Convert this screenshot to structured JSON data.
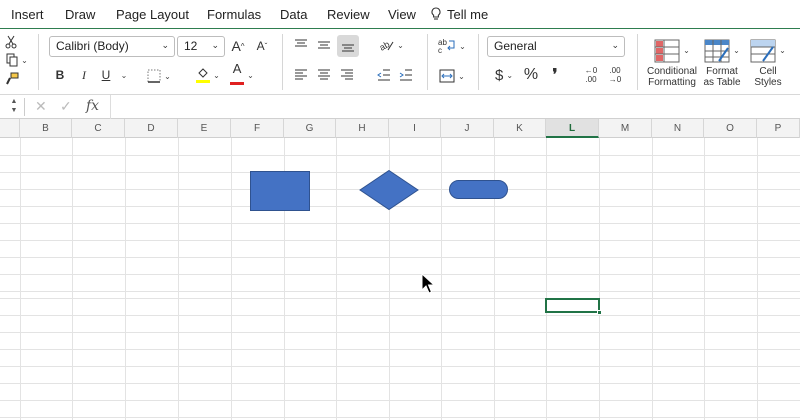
{
  "menu": {
    "tabs": [
      "Insert",
      "Draw",
      "Page Layout",
      "Formulas",
      "Data",
      "Review",
      "View"
    ],
    "tell_me": "Tell me"
  },
  "ribbon": {
    "font_name": "Calibri (Body)",
    "font_size": "12",
    "number_format": "General",
    "bold": "B",
    "italic": "I",
    "underline": "U",
    "font_color_letter": "A",
    "currency": "$",
    "percent": "%",
    "comma": "❜",
    "increase_decimal_top": "←0",
    "increase_decimal_bottom": ".00",
    "decrease_decimal_top": ".00",
    "decrease_decimal_bottom": "→0",
    "conditional_formatting": [
      "Conditional",
      "Formatting"
    ],
    "format_as_table": [
      "Format",
      "as Table"
    ],
    "cell_styles": [
      "Cell",
      "Styles"
    ]
  },
  "formula_bar": {
    "fx": "fx",
    "value": ""
  },
  "columns": [
    "B",
    "C",
    "D",
    "E",
    "F",
    "G",
    "H",
    "I",
    "J",
    "K",
    "L",
    "M",
    "N",
    "O",
    "P"
  ],
  "active_column": "L",
  "shapes": [
    {
      "type": "rectangle",
      "fill": "#4472c4"
    },
    {
      "type": "diamond",
      "fill": "#4472c4"
    },
    {
      "type": "rounded-rectangle",
      "fill": "#4472c4"
    }
  ],
  "colors": {
    "accent": "#217346",
    "shape_fill": "#4472c4",
    "shape_stroke": "#2f528f",
    "highlight": "#ffff00",
    "font_red": "#e02020"
  }
}
